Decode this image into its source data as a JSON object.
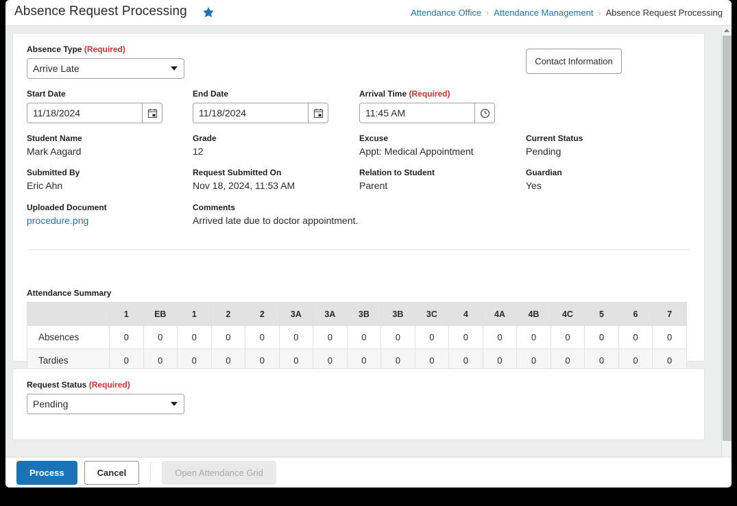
{
  "header": {
    "title": "Absence Request Processing",
    "star_icon": "star-icon",
    "breadcrumb": {
      "items": [
        {
          "label": "Attendance Office",
          "link": true
        },
        {
          "label": "Attendance Management",
          "link": true
        },
        {
          "label": "Absence Request Processing",
          "link": false
        }
      ],
      "separator": "›"
    }
  },
  "form": {
    "absence_type": {
      "label": "Absence Type",
      "required_text": "(Required)",
      "value": "Arrive Late"
    },
    "start_date": {
      "label": "Start Date",
      "value": "11/18/2024",
      "icon": "calendar-icon"
    },
    "end_date": {
      "label": "End Date",
      "value": "11/18/2024",
      "icon": "calendar-icon"
    },
    "arrival_time": {
      "label": "Arrival Time",
      "required_text": "(Required)",
      "value": "11:45 AM",
      "icon": "clock-icon"
    },
    "contact_information_button": "Contact Information"
  },
  "details": [
    {
      "label": "Student Name",
      "value": "Mark Aagard"
    },
    {
      "label": "Grade",
      "value": "12"
    },
    {
      "label": "Excuse",
      "value": "Appt: Medical Appointment"
    },
    {
      "label": "Current Status",
      "value": "Pending"
    },
    {
      "label": "Submitted By",
      "value": "Eric Ahn"
    },
    {
      "label": "Request Submitted On",
      "value": "Nov 18, 2024, 11:53 AM"
    },
    {
      "label": "Relation to Student",
      "value": "Parent"
    },
    {
      "label": "Guardian",
      "value": "Yes"
    }
  ],
  "uploaded_document": {
    "label": "Uploaded Document",
    "file_name": "procedure.png"
  },
  "comments": {
    "label": "Comments",
    "text": "Arrived late due to doctor appointment."
  },
  "attendance_summary": {
    "title": "Attendance Summary",
    "columns": [
      "",
      "1",
      "EB",
      "1",
      "2",
      "2",
      "3A",
      "3A",
      "3B",
      "3B",
      "3C",
      "4",
      "4A",
      "4B",
      "4C",
      "5",
      "6",
      "7"
    ],
    "rows": [
      {
        "label": "Absences",
        "values": [
          "0",
          "0",
          "0",
          "0",
          "0",
          "0",
          "0",
          "0",
          "0",
          "0",
          "0",
          "0",
          "0",
          "0",
          "0",
          "0",
          "0"
        ]
      },
      {
        "label": "Tardies",
        "values": [
          "0",
          "0",
          "0",
          "0",
          "0",
          "0",
          "0",
          "0",
          "0",
          "0",
          "0",
          "0",
          "0",
          "0",
          "0",
          "0",
          "0"
        ]
      }
    ]
  },
  "request_status": {
    "label": "Request Status",
    "required_text": "(Required)",
    "value": "Pending"
  },
  "footer": {
    "process_label": "Process",
    "cancel_label": "Cancel",
    "open_grid_label": "Open Attendance Grid"
  },
  "colors": {
    "accent": "#1a73b7",
    "required": "#d03030",
    "page_bg": "#eceded",
    "table_header": "#e2e2e2"
  }
}
